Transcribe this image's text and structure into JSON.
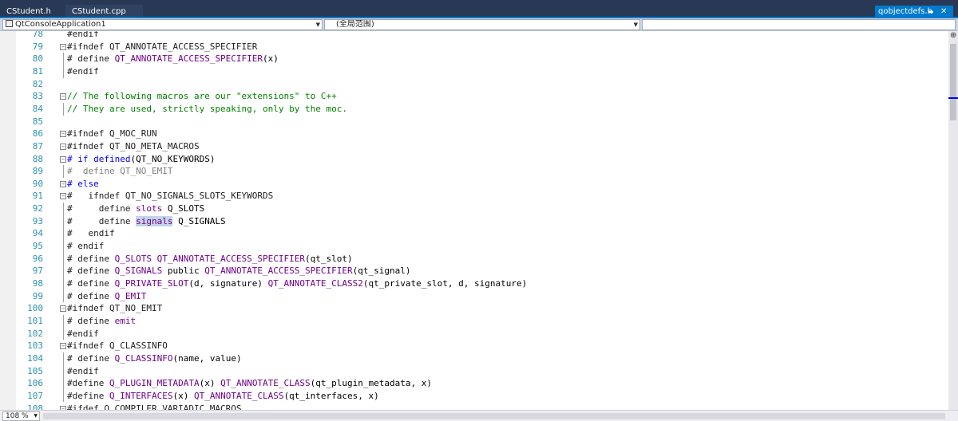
{
  "tabs": {
    "left": [
      {
        "label": "CStudent.h"
      },
      {
        "label": "CStudent.cpp"
      }
    ],
    "active": {
      "label": "qobjectdefs.h",
      "pin_icon": "pin-icon",
      "close_icon": "close-icon"
    }
  },
  "navigation": {
    "project": "QtConsoleApplication1",
    "scope": "(全局范围)",
    "member": ""
  },
  "editor": {
    "lines": [
      {
        "n": "78",
        "fold": "",
        "segs": [
          {
            "t": "#endif",
            "c": "t-dir"
          }
        ]
      },
      {
        "n": "79",
        "fold": "box",
        "segs": [
          {
            "t": "#ifndef QT_ANNOTATE_ACCESS_SPECIFIER",
            "c": "t-dir"
          }
        ]
      },
      {
        "n": "80",
        "fold": "line",
        "segs": [
          {
            "t": "# define ",
            "c": "t-dir"
          },
          {
            "t": "QT_ANNOTATE_ACCESS_SPECIFIER",
            "c": "t-macro"
          },
          {
            "t": "(x)",
            "c": "t-plain"
          }
        ]
      },
      {
        "n": "81",
        "fold": "line",
        "segs": [
          {
            "t": "#endif",
            "c": "t-dir"
          }
        ]
      },
      {
        "n": "82",
        "fold": "",
        "segs": []
      },
      {
        "n": "83",
        "fold": "box",
        "segs": [
          {
            "t": "// The following macros are our \"extensions\" to C++",
            "c": "t-cmt"
          }
        ]
      },
      {
        "n": "84",
        "fold": "line",
        "segs": [
          {
            "t": "// They are used, strictly speaking, only by the moc.",
            "c": "t-cmt"
          }
        ]
      },
      {
        "n": "85",
        "fold": "",
        "segs": []
      },
      {
        "n": "86",
        "fold": "box",
        "segs": [
          {
            "t": "#ifndef Q_MOC_RUN",
            "c": "t-dir"
          }
        ]
      },
      {
        "n": "87",
        "fold": "box",
        "segs": [
          {
            "t": "#ifndef QT_NO_META_MACROS",
            "c": "t-dir"
          }
        ]
      },
      {
        "n": "88",
        "fold": "box",
        "segs": [
          {
            "t": "# if ",
            "c": "t-kw"
          },
          {
            "t": "defined",
            "c": "t-kw"
          },
          {
            "t": "(QT_NO_KEYWORDS)",
            "c": "t-plain"
          }
        ]
      },
      {
        "n": "89",
        "fold": "line",
        "segs": [
          {
            "t": "#  define QT_NO_EMIT",
            "c": "t-gray"
          }
        ]
      },
      {
        "n": "90",
        "fold": "box",
        "segs": [
          {
            "t": "# else",
            "c": "t-kw"
          }
        ]
      },
      {
        "n": "91",
        "fold": "box",
        "segs": [
          {
            "t": "#   ifndef QT_NO_SIGNALS_SLOTS_KEYWORDS",
            "c": "t-dir"
          }
        ]
      },
      {
        "n": "92",
        "fold": "line",
        "segs": [
          {
            "t": "#     define ",
            "c": "t-dir"
          },
          {
            "t": "slots",
            "c": "t-macro"
          },
          {
            "t": " Q_SLOTS",
            "c": "t-plain"
          }
        ]
      },
      {
        "n": "93",
        "fold": "line",
        "segs": [
          {
            "t": "#     define ",
            "c": "t-dir"
          },
          {
            "t": "signals",
            "c": "t-macro hl"
          },
          {
            "t": " Q_SIGNALS",
            "c": "t-plain"
          }
        ]
      },
      {
        "n": "94",
        "fold": "line",
        "segs": [
          {
            "t": "#   endif",
            "c": "t-dir"
          }
        ]
      },
      {
        "n": "95",
        "fold": "line",
        "segs": [
          {
            "t": "# endif",
            "c": "t-dir"
          }
        ]
      },
      {
        "n": "96",
        "fold": "line",
        "segs": [
          {
            "t": "# define ",
            "c": "t-dir"
          },
          {
            "t": "Q_SLOTS",
            "c": "t-macro"
          },
          {
            "t": " ",
            "c": "t-plain"
          },
          {
            "t": "QT_ANNOTATE_ACCESS_SPECIFIER",
            "c": "t-macro"
          },
          {
            "t": "(qt_slot)",
            "c": "t-plain"
          }
        ]
      },
      {
        "n": "97",
        "fold": "line",
        "segs": [
          {
            "t": "# define ",
            "c": "t-dir"
          },
          {
            "t": "Q_SIGNALS",
            "c": "t-macro"
          },
          {
            "t": " public ",
            "c": "t-plain"
          },
          {
            "t": "QT_ANNOTATE_ACCESS_SPECIFIER",
            "c": "t-macro"
          },
          {
            "t": "(qt_signal)",
            "c": "t-plain"
          }
        ]
      },
      {
        "n": "98",
        "fold": "line",
        "segs": [
          {
            "t": "# define ",
            "c": "t-dir"
          },
          {
            "t": "Q_PRIVATE_SLOT",
            "c": "t-macro"
          },
          {
            "t": "(d, signature) ",
            "c": "t-plain"
          },
          {
            "t": "QT_ANNOTATE_CLASS2",
            "c": "t-macro"
          },
          {
            "t": "(qt_private_slot, d, signature)",
            "c": "t-plain"
          }
        ]
      },
      {
        "n": "99",
        "fold": "line",
        "segs": [
          {
            "t": "# define ",
            "c": "t-dir"
          },
          {
            "t": "Q_EMIT",
            "c": "t-macro"
          }
        ]
      },
      {
        "n": "100",
        "fold": "box",
        "segs": [
          {
            "t": "#ifndef QT_NO_EMIT",
            "c": "t-dir"
          }
        ]
      },
      {
        "n": "101",
        "fold": "line",
        "segs": [
          {
            "t": "# define ",
            "c": "t-dir"
          },
          {
            "t": "emit",
            "c": "t-macro"
          }
        ]
      },
      {
        "n": "102",
        "fold": "line",
        "segs": [
          {
            "t": "#endif",
            "c": "t-dir"
          }
        ]
      },
      {
        "n": "103",
        "fold": "box",
        "segs": [
          {
            "t": "#ifndef Q_CLASSINFO",
            "c": "t-dir"
          }
        ]
      },
      {
        "n": "104",
        "fold": "line",
        "segs": [
          {
            "t": "# define ",
            "c": "t-dir"
          },
          {
            "t": "Q_CLASSINFO",
            "c": "t-macro"
          },
          {
            "t": "(name, value)",
            "c": "t-plain"
          }
        ]
      },
      {
        "n": "105",
        "fold": "line",
        "segs": [
          {
            "t": "#endif",
            "c": "t-dir"
          }
        ]
      },
      {
        "n": "106",
        "fold": "line",
        "segs": [
          {
            "t": "#define ",
            "c": "t-dir"
          },
          {
            "t": "Q_PLUGIN_METADATA",
            "c": "t-macro"
          },
          {
            "t": "(x) ",
            "c": "t-plain"
          },
          {
            "t": "QT_ANNOTATE_CLASS",
            "c": "t-macro"
          },
          {
            "t": "(qt_plugin_metadata, x)",
            "c": "t-plain"
          }
        ]
      },
      {
        "n": "107",
        "fold": "line",
        "segs": [
          {
            "t": "#define ",
            "c": "t-dir"
          },
          {
            "t": "Q_INTERFACES",
            "c": "t-macro"
          },
          {
            "t": "(x) ",
            "c": "t-plain"
          },
          {
            "t": "QT_ANNOTATE_CLASS",
            "c": "t-macro"
          },
          {
            "t": "(qt_interfaces, x)",
            "c": "t-plain"
          }
        ]
      },
      {
        "n": "108",
        "fold": "box",
        "segs": [
          {
            "t": "#ifdef Q_COMPILER_VARIADIC_MACROS",
            "c": "t-dir"
          }
        ]
      }
    ]
  },
  "scrollbar": {
    "split_icon": "split-icon"
  },
  "status": {
    "zoom": "108 %"
  }
}
